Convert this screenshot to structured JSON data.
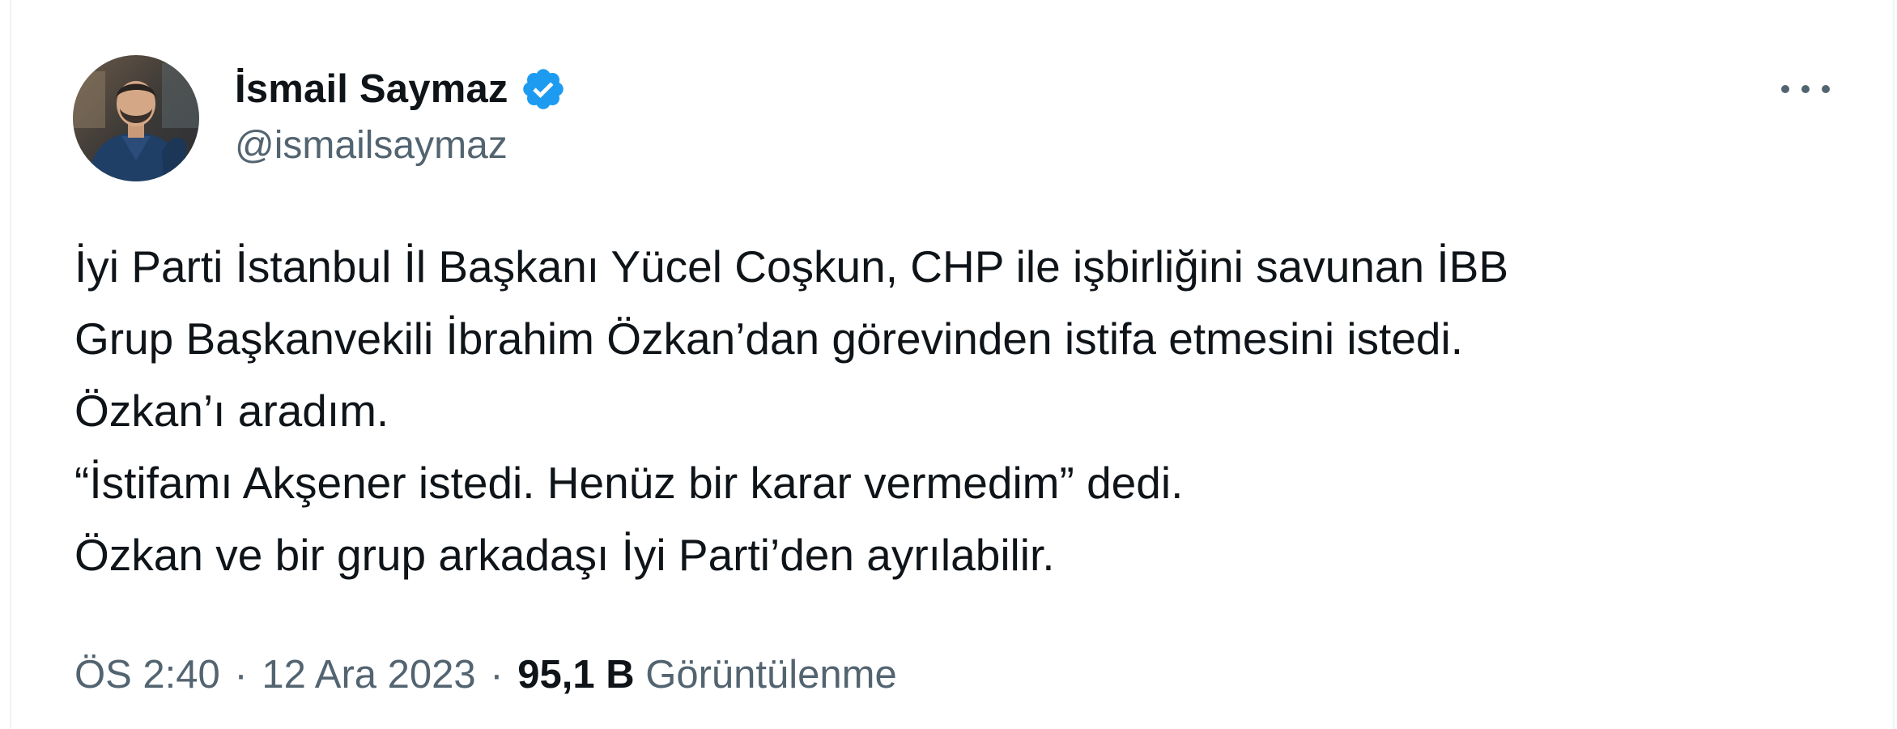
{
  "author": {
    "display_name": "İsmail Saymaz",
    "handle": "@ismailsaymaz",
    "verified": true,
    "verified_color": "#1d9bf0"
  },
  "tweet": {
    "lines": [
      "İyi Parti İstanbul İl Başkanı Yücel Coşkun, CHP ile işbirliğini savunan İBB",
      "Grup Başkanvekili İbrahim Özkan’dan görevinden istifa etmesini istedi.",
      "Özkan’ı aradım.",
      "“İstifamı Akşener istedi. Henüz bir karar vermedim” dedi.",
      "Özkan ve bir grup arkadaşı İyi Parti’den ayrılabilir."
    ]
  },
  "meta": {
    "time": "ÖS 2:40",
    "separator": "·",
    "date": "12 Ara 2023",
    "views_count": "95,1 B",
    "views_label": "Görüntülenme"
  },
  "icons": {
    "verified": "verified-badge-icon",
    "more": "more-options-icon"
  },
  "colors": {
    "text_primary": "#0f1419",
    "text_secondary": "#536471",
    "accent": "#1d9bf0"
  }
}
